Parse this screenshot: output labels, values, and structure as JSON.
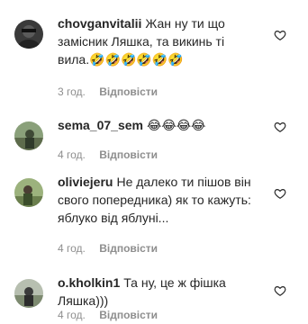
{
  "comments": [
    {
      "username": "chovganvitalii",
      "text_line1": "Жан ну ти що",
      "text_line2": "замісник Ляшка, та викинь ті",
      "text_line3": "вила.",
      "emojis": "🤣🤣🤣🤣🤣🤣",
      "time": "3 год.",
      "reply_label": "Відповісти",
      "avatar_icon": "user-avatar-dark",
      "like_icon": "heart-outline-icon"
    },
    {
      "username": "sema_07_sem",
      "text": "😂😂😂😂",
      "time": "4 год.",
      "reply_label": "Відповісти",
      "avatar_icon": "user-avatar-outdoor",
      "like_icon": "heart-outline-icon"
    },
    {
      "username": "oliviejeru",
      "text_line1": "Не далеко ти пішов він",
      "text_line2": "свого попередника) як то кажуть:",
      "text_line3": "яблуко від яблуні...",
      "time": "4 год.",
      "reply_label": "Відповісти",
      "avatar_icon": "user-avatar-outdoor",
      "like_icon": "heart-outline-icon"
    },
    {
      "username": "o.kholkin1",
      "text_line1": "Та ну, це ж фішка",
      "text_line2": "Ляшка)))",
      "time": "4 год.",
      "reply_label": "Відповісти",
      "avatar_icon": "user-avatar-outdoor",
      "like_icon": "heart-outline-icon"
    }
  ],
  "colors": {
    "text": "#262626",
    "meta": "#8e8e8e",
    "background": "#ffffff"
  }
}
